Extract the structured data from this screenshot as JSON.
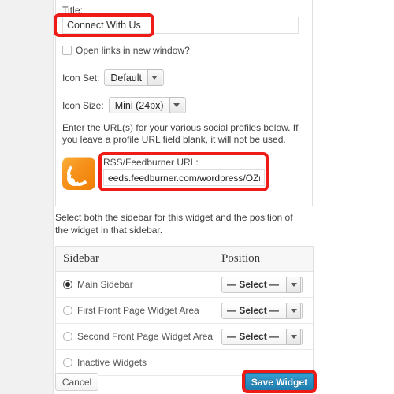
{
  "form": {
    "title_label": "Title:",
    "title_value": "Connect With Us",
    "open_links_label": "Open links in new window?",
    "open_links_checked": false,
    "icon_set_label": "Icon Set:",
    "icon_set_value": "Default",
    "icon_size_label": "Icon Size:",
    "icon_size_value": "Mini (24px)",
    "helper_text": "Enter the URL(s) for your various social profiles below. If you leave a profile URL field blank, it will not be used.",
    "rss": {
      "icon_name": "rss-icon",
      "label": "RSS/Feedburner URL:",
      "value": "eeds.feedburner.com/wordpress/OZmo"
    }
  },
  "sidebar_section": {
    "intro_text": "Select both the sidebar for this widget and the position of the widget in that sidebar.",
    "columns": [
      "Sidebar",
      "Position"
    ],
    "rows": [
      {
        "label": "Main Sidebar",
        "selected": true,
        "position": "— Select —",
        "has_position": true
      },
      {
        "label": "First Front Page Widget Area",
        "selected": false,
        "position": "— Select —",
        "has_position": true
      },
      {
        "label": "Second Front Page Widget Area",
        "selected": false,
        "position": "— Select —",
        "has_position": true
      },
      {
        "label": "Inactive Widgets",
        "selected": false,
        "position": "",
        "has_position": false
      }
    ]
  },
  "actions": {
    "cancel_label": "Cancel",
    "save_label": "Save Widget"
  },
  "annotations": {
    "color": "#ee1b17",
    "targets": [
      "title-input",
      "rss-url-field",
      "save-widget-button"
    ]
  },
  "colors": {
    "page_background": "#f1f1f1",
    "panel_background": "#ffffff",
    "save_button": "#2b8fc4",
    "rss_orange": "#f7941e",
    "annotation_red": "#ee1b17"
  }
}
